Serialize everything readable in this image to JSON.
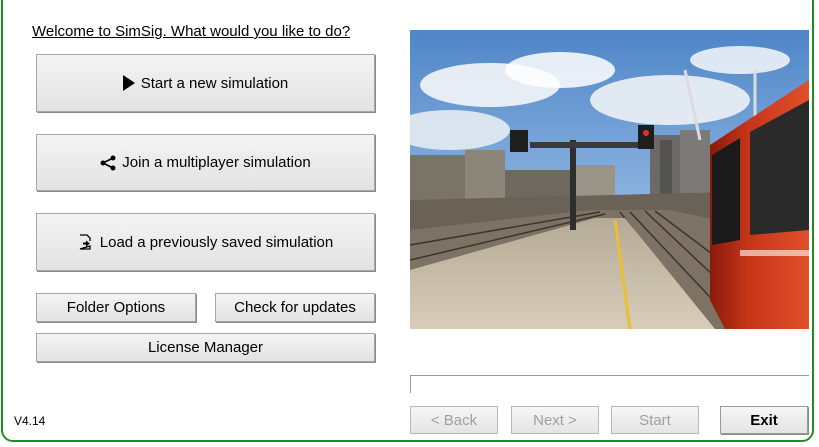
{
  "welcome_text": "Welcome to SimSig. What would you like to do?",
  "buttons": {
    "new_sim": "Start a new simulation",
    "join_multi": "Join a multiplayer simulation",
    "load_saved": "Load a previously saved simulation",
    "folder_options": "Folder Options",
    "check_updates": "Check for updates",
    "license_manager": "License Manager"
  },
  "icons": {
    "new_sim": "play-arrow-icon",
    "join_multi": "share-icon",
    "load_saved": "file-open-icon"
  },
  "nav": {
    "back": "< Back",
    "next": "Next >",
    "start": "Start",
    "exit": "Exit"
  },
  "version": "V4.14",
  "colors": {
    "frame_border": "#1e8f1e",
    "disabled_text": "#a0a0a0"
  }
}
